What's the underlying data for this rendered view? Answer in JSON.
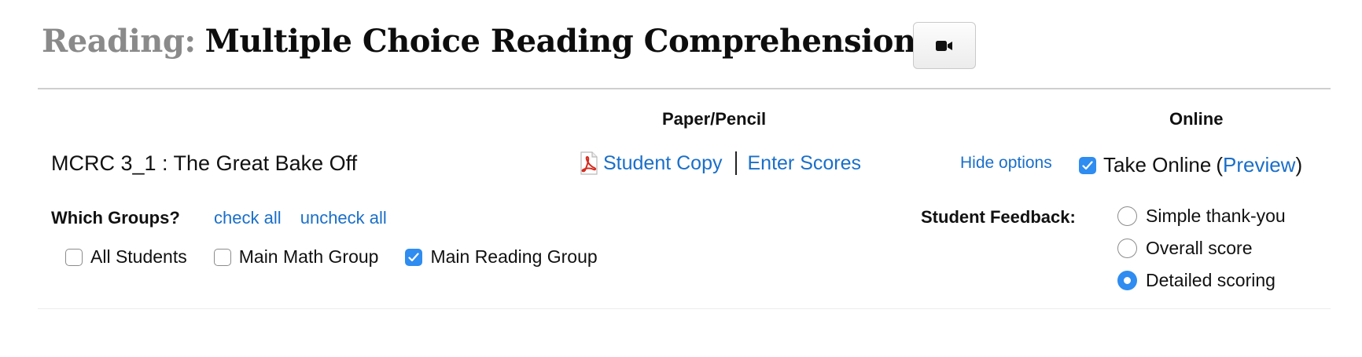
{
  "header": {
    "subject": "Reading:",
    "title": "Multiple Choice Reading Comprehension",
    "video_button_icon": "video-camera-icon"
  },
  "columns": {
    "paper": "Paper/Pencil",
    "online": "Online"
  },
  "assessment": {
    "name": "MCRC 3_1 : The Great Bake Off",
    "pdf_icon": "pdf-icon",
    "student_copy": "Student Copy",
    "separator": "|",
    "enter_scores": "Enter Scores",
    "hide_options": "Hide options",
    "take_online": {
      "checked": true,
      "label": "Take Online",
      "paren_open": "(",
      "preview": "Preview",
      "paren_close": ")"
    }
  },
  "groups": {
    "label": "Which Groups?",
    "check_all": "check all",
    "uncheck_all": "uncheck all",
    "items": [
      {
        "label": "All Students",
        "checked": false
      },
      {
        "label": "Main Math Group",
        "checked": false
      },
      {
        "label": "Main Reading Group",
        "checked": true
      }
    ]
  },
  "feedback": {
    "label": "Student Feedback:",
    "options": [
      {
        "label": "Simple thank-you",
        "selected": false
      },
      {
        "label": "Overall score",
        "selected": false
      },
      {
        "label": "Detailed scoring",
        "selected": true
      }
    ]
  },
  "colors": {
    "link": "#1a6fc9",
    "checked": "#2f8cf0",
    "subject": "#8a8a8a"
  }
}
